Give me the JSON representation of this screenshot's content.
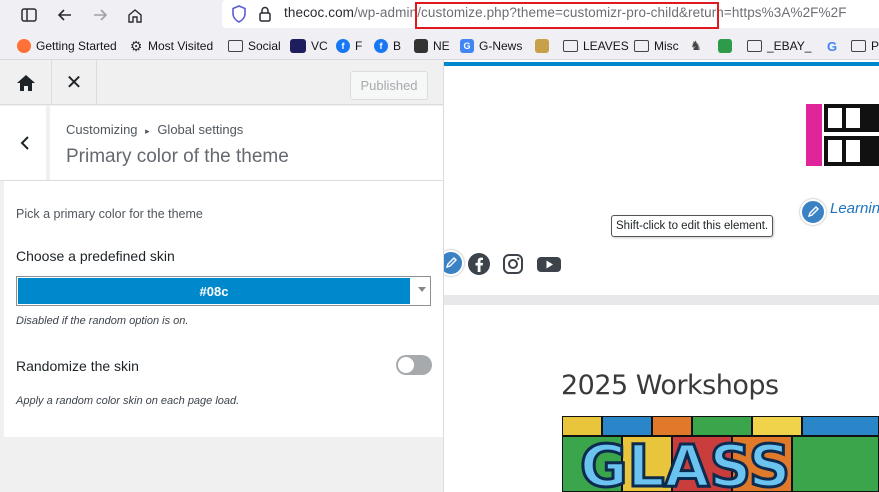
{
  "browser": {
    "url_domain": "thecoc.com",
    "url_path": "/wp-admin/customize.php?theme=customizr-pro-child&return=https%3A%2F%2F",
    "bookmarks": [
      {
        "label": "Getting Started",
        "icon": "firefox-icon"
      },
      {
        "label": "Most Visited",
        "icon": "gear-icon"
      },
      {
        "label": "Social",
        "icon": "folder-icon"
      },
      {
        "label": "VC",
        "icon": "vc-icon"
      },
      {
        "label": "F",
        "icon": "facebook-icon"
      },
      {
        "label": "B",
        "icon": "facebook-icon"
      },
      {
        "label": "NE",
        "icon": "ne-icon"
      },
      {
        "label": "G-News",
        "icon": "gnews-icon"
      },
      {
        "label": "LEAVES",
        "icon": "folder-icon"
      },
      {
        "label": "Misc",
        "icon": "folder-icon"
      },
      {
        "label": "_EBAY_",
        "icon": "folder-icon"
      },
      {
        "label": "G",
        "icon": "google-icon"
      },
      {
        "label": "P",
        "icon": "folder-icon"
      }
    ]
  },
  "customizer": {
    "publish_label": "Published",
    "breadcrumb_root": "Customizing",
    "breadcrumb_sep": "▸",
    "breadcrumb_section": "Global settings",
    "section_title": "Primary color of the theme",
    "description": "Pick a primary color for the theme",
    "skin_label": "Choose a predefined skin",
    "skin_value": "#08c",
    "skin_color": "#0088cc",
    "skin_note": "Disabled if the random option is on.",
    "randomize_label": "Randomize the skin",
    "randomize_on": false,
    "randomize_note": "Apply a random color skin on each page load."
  },
  "preview": {
    "learning_link": "Learnin",
    "tooltip": "Shift-click to edit this element.",
    "workshops_title": "2025 Workshops",
    "accent_color": "#0088cc"
  }
}
